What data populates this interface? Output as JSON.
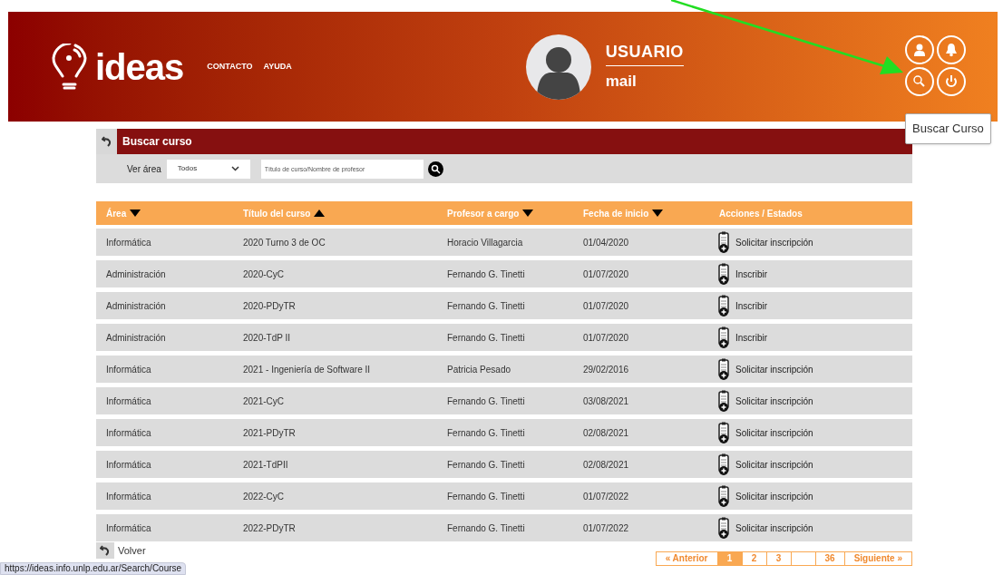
{
  "header": {
    "logo": "ideas",
    "nav": [
      "CONTACTO",
      "AYUDA"
    ],
    "user": {
      "name": "USUARIO",
      "mail": "mail"
    },
    "icons": [
      {
        "kind": "user"
      },
      {
        "kind": "bell"
      },
      {
        "kind": "search"
      },
      {
        "kind": "power"
      }
    ],
    "tooltip": "Buscar Curso"
  },
  "search_panel": {
    "title": "Buscar curso",
    "area_label": "Ver área",
    "area_value": "Todos",
    "placeholder": "Título de curso/Nombre de profesor"
  },
  "table": {
    "columns": [
      {
        "label": "Área",
        "sorted": true,
        "ascending": false
      },
      {
        "label": "Título del curso",
        "sorted": true,
        "ascending": true
      },
      {
        "label": "Profesor a cargo",
        "sorted": true,
        "ascending": false
      },
      {
        "label": "Fecha de inicio",
        "sorted": true,
        "ascending": false
      },
      {
        "label": "Acciones / Estados",
        "sorted": false
      }
    ],
    "rows": [
      {
        "area": "Informática",
        "title": "2020 Turno 3 de OC",
        "professor": "Horacio Villagarcia",
        "date": "01/04/2020",
        "action": "Solicitar inscripción"
      },
      {
        "area": "Administración",
        "title": "2020-CyC",
        "professor": "Fernando G. Tinetti",
        "date": "01/07/2020",
        "action": "Inscribir"
      },
      {
        "area": "Administración",
        "title": "2020-PDyTR",
        "professor": "Fernando G. Tinetti",
        "date": "01/07/2020",
        "action": "Inscribir"
      },
      {
        "area": "Administración",
        "title": "2020-TdP II",
        "professor": "Fernando G. Tinetti",
        "date": "01/07/2020",
        "action": "Inscribir"
      },
      {
        "area": "Informática",
        "title": "2021 - Ingeniería de Software II",
        "professor": "Patricia Pesado",
        "date": "29/02/2016",
        "action": "Solicitar inscripción"
      },
      {
        "area": "Informática",
        "title": "2021-CyC",
        "professor": "Fernando G. Tinetti",
        "date": "03/08/2021",
        "action": "Solicitar inscripción"
      },
      {
        "area": "Informática",
        "title": "2021-PDyTR",
        "professor": "Fernando G. Tinetti",
        "date": "02/08/2021",
        "action": "Solicitar inscripción"
      },
      {
        "area": "Informática",
        "title": "2021-TdPII",
        "professor": "Fernando G. Tinetti",
        "date": "02/08/2021",
        "action": "Solicitar inscripción"
      },
      {
        "area": "Informática",
        "title": "2022-CyC",
        "professor": "Fernando G. Tinetti",
        "date": "01/07/2022",
        "action": "Solicitar inscripción"
      },
      {
        "area": "Informática",
        "title": "2022-PDyTR",
        "professor": "Fernando G. Tinetti",
        "date": "01/07/2022",
        "action": "Solicitar inscripción"
      }
    ]
  },
  "back_label": "Volver",
  "pagination": [
    {
      "label": "« Anterior",
      "selected": false
    },
    {
      "label": "1",
      "selected": true
    },
    {
      "label": "2",
      "selected": false
    },
    {
      "label": "3",
      "selected": false
    },
    {
      "selected": false
    },
    {
      "label": "36",
      "selected": false
    },
    {
      "label": "Siguiente »",
      "selected": false
    }
  ],
  "status_url": "https://ideas.info.unlp.edu.ar/Search/Course"
}
